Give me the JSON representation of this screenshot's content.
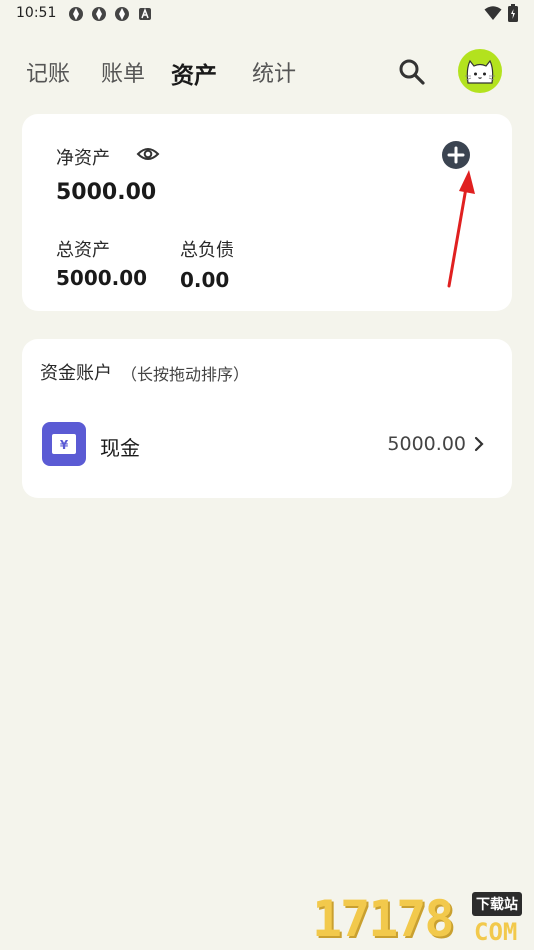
{
  "status": {
    "time": "10:51"
  },
  "nav": {
    "tabs": [
      "记账",
      "账单",
      "资产",
      "统计"
    ],
    "active_tab": "资产"
  },
  "net": {
    "label": "净资产",
    "value": "5000.00",
    "total_assets_label": "总资产",
    "total_assets_value": "5000.00",
    "total_liab_label": "总负债",
    "total_liab_value": "0.00"
  },
  "accounts": {
    "title": "资金账户",
    "hint": "（长按拖动排序）",
    "items": [
      {
        "name": "现金",
        "amount": "5000.00",
        "icon": "yen-wallet-icon",
        "icon_color": "#5b5bd4"
      }
    ]
  },
  "watermark": {
    "num": "17178",
    "cn": "下载站",
    "com": "COM"
  },
  "colors": {
    "background": "#f4f4ec",
    "card": "#ffffff",
    "accent": "#5b5bd4",
    "avatar_bg": "#b3e21e",
    "arrow": "#e02020"
  }
}
